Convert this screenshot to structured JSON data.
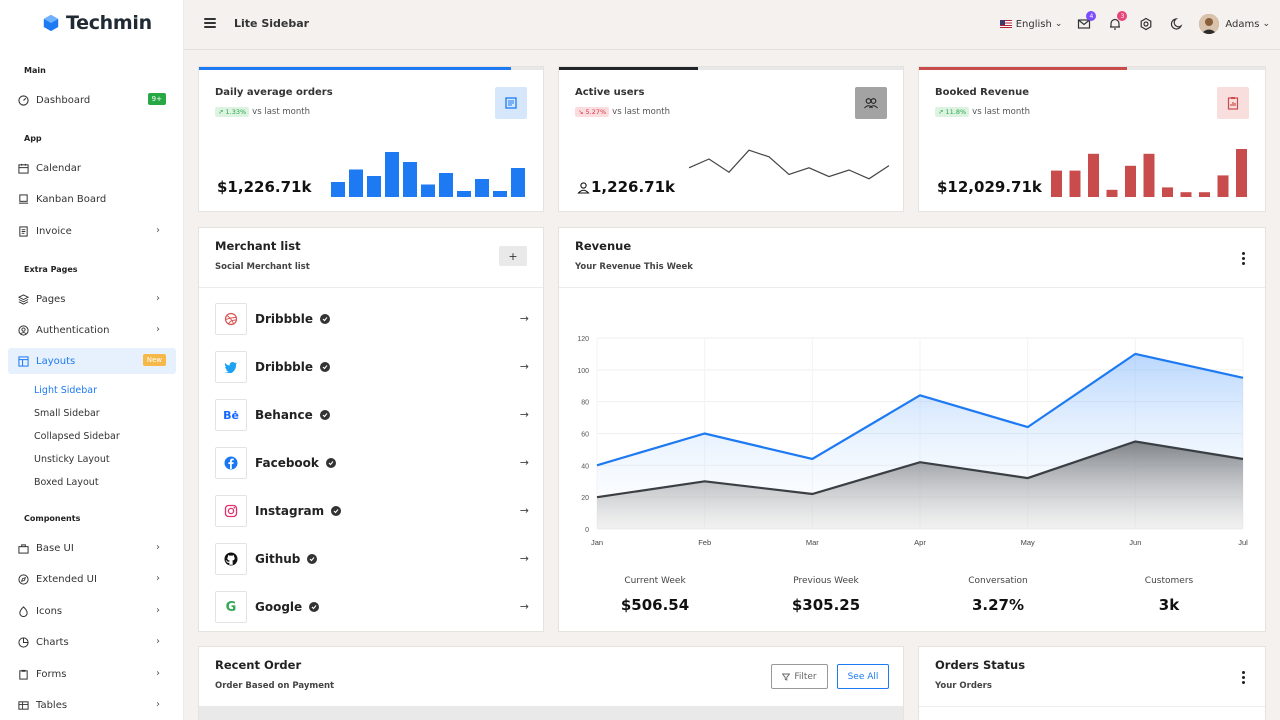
{
  "app": {
    "brand": "Techmin",
    "page_title": "Lite Sidebar"
  },
  "colors": {
    "accent": "#1d7af3",
    "dark": "#212529",
    "danger": "#c94c4c",
    "success": "#28a745"
  },
  "sidebar": {
    "sections": [
      "Main",
      "App",
      "Extra Pages",
      "Components"
    ],
    "items": [
      {
        "label": "Dashboard",
        "icon": "dashboard-icon",
        "badge": "9+"
      },
      {
        "label": "Calendar",
        "icon": "calendar-icon"
      },
      {
        "label": "Kanban Board",
        "icon": "kanban-icon"
      },
      {
        "label": "Invoice",
        "icon": "invoice-icon"
      },
      {
        "label": "Pages",
        "icon": "pages-icon"
      },
      {
        "label": "Authentication",
        "icon": "auth-icon"
      },
      {
        "label": "Layouts",
        "icon": "layout-icon",
        "badge": "New"
      },
      {
        "label": "Base UI",
        "icon": "base-ui-icon"
      },
      {
        "label": "Extended UI",
        "icon": "extended-ui-icon"
      },
      {
        "label": "Icons",
        "icon": "icons-icon"
      },
      {
        "label": "Charts",
        "icon": "charts-icon"
      },
      {
        "label": "Forms",
        "icon": "forms-icon"
      },
      {
        "label": "Tables",
        "icon": "tables-icon"
      }
    ],
    "layout_sub": [
      "Light Sidebar",
      "Small Sidebar",
      "Collapsed Sidebar",
      "Unsticky Layout",
      "Boxed Layout"
    ]
  },
  "header": {
    "language": "English",
    "mail_count": "4",
    "notif_count": "3",
    "user": "Adams"
  },
  "kpis": [
    {
      "title": "Daily average orders",
      "change": "1.33%",
      "direction": "up",
      "suffix": "vs last month",
      "value": "$1,226.71k",
      "color": "#1d7af3"
    },
    {
      "title": "Active users",
      "change": "5.27%",
      "direction": "down",
      "suffix": "vs last month",
      "value": "1,226.71k",
      "color": "#212529"
    },
    {
      "title": "Booked Revenue",
      "change": "11.8%",
      "direction": "up",
      "suffix": "vs last month",
      "value": "$12,029.71k",
      "color": "#c94c4c"
    }
  ],
  "kpi_sparks": {
    "orders": [
      30,
      55,
      42,
      90,
      70,
      25,
      48,
      12,
      36,
      12,
      58
    ],
    "users": [
      55,
      75,
      45,
      95,
      80,
      40,
      55,
      35,
      50,
      30,
      60
    ],
    "revenue": [
      55,
      55,
      90,
      15,
      65,
      90,
      20,
      10,
      10,
      45,
      100
    ]
  },
  "merchants": {
    "title": "Merchant list",
    "subtitle": "Social Merchant list",
    "add_label": "+",
    "items": [
      {
        "name": "Dribbble",
        "icon": "dribbble-icon"
      },
      {
        "name": "Dribbble",
        "icon": "twitter-icon"
      },
      {
        "name": "Behance",
        "icon": "behance-icon"
      },
      {
        "name": "Facebook",
        "icon": "facebook-icon"
      },
      {
        "name": "Instagram",
        "icon": "instagram-icon"
      },
      {
        "name": "Github",
        "icon": "github-icon"
      },
      {
        "name": "Google",
        "icon": "google-icon"
      }
    ]
  },
  "revenue": {
    "title": "Revenue",
    "subtitle": "Your Revenue This Week",
    "stats": [
      {
        "label": "Current Week",
        "value": "$506.54"
      },
      {
        "label": "Previous Week",
        "value": "$305.25"
      },
      {
        "label": "Conversation",
        "value": "3.27%"
      },
      {
        "label": "Customers",
        "value": "3k"
      }
    ]
  },
  "chart_data": {
    "type": "area",
    "x": [
      "Jan",
      "Feb",
      "Mar",
      "Apr",
      "May",
      "Jun",
      "Jul"
    ],
    "ylim": [
      0,
      120
    ],
    "yticks": [
      0,
      20,
      40,
      60,
      80,
      100,
      120
    ],
    "series": [
      {
        "values": [
          40,
          60,
          44,
          84,
          64,
          110,
          95
        ],
        "color": "#1d7af3"
      },
      {
        "values": [
          20,
          30,
          22,
          42,
          32,
          55,
          44
        ],
        "color": "#3a3f44"
      }
    ]
  },
  "recent_order": {
    "title": "Recent Order",
    "subtitle": "Order Based on Payment",
    "filter_label": "Filter",
    "see_all_label": "See All"
  },
  "orders_status": {
    "title": "Orders Status",
    "subtitle": "Your Orders"
  }
}
